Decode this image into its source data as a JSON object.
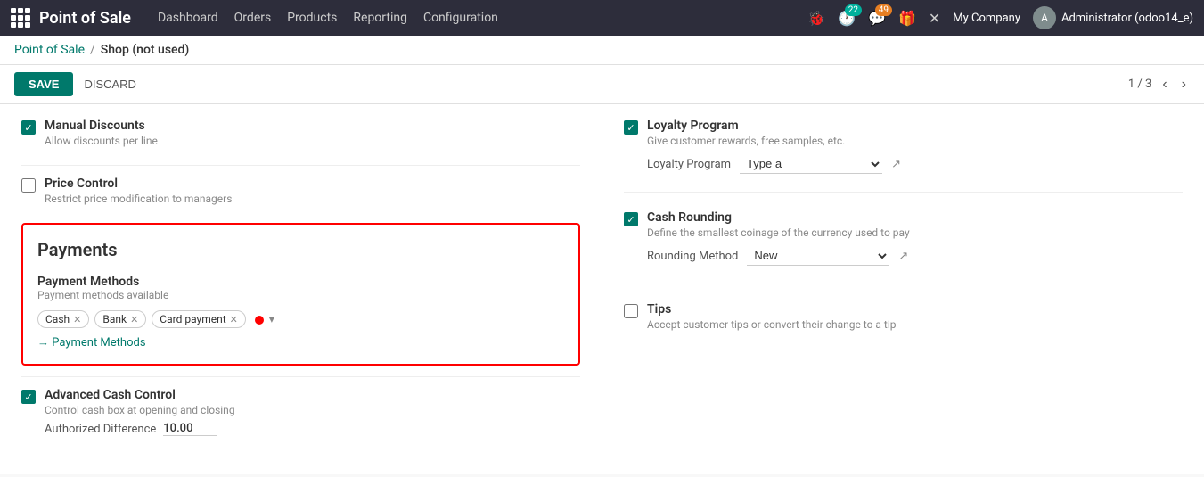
{
  "app": {
    "title": "Point of Sale"
  },
  "nav": {
    "links": [
      "Dashboard",
      "Orders",
      "Products",
      "Reporting",
      "Configuration"
    ],
    "notification_count": "22",
    "message_count": "49",
    "company": "My Company",
    "user": "Administrator (odoo14_e)"
  },
  "breadcrumb": {
    "parent": "Point of Sale",
    "separator": "/",
    "current": "Shop (not used)"
  },
  "action_bar": {
    "save_label": "SAVE",
    "discard_label": "DISCARD",
    "pagination": "1 / 3"
  },
  "left": {
    "manual_discounts": {
      "title": "Manual Discounts",
      "description": "Allow discounts per line",
      "checked": true
    },
    "price_control": {
      "title": "Price Control",
      "description": "Restrict price modification to managers",
      "checked": false
    },
    "payments": {
      "section_title": "Payments",
      "payment_methods_label": "Payment Methods",
      "payment_methods_desc": "Payment methods available",
      "tags": [
        "Cash",
        "Bank",
        "Card payment"
      ],
      "payment_link": "→ Payment Methods"
    },
    "advanced_cash": {
      "title": "Advanced Cash Control",
      "description": "Control cash box at opening and closing",
      "checked": true,
      "authorized_label": "Authorized Difference",
      "authorized_value": "10.00"
    }
  },
  "right": {
    "loyalty_program": {
      "title": "Loyalty Program",
      "description": "Give customer rewards, free samples, etc.",
      "field_label": "Loyalty Program",
      "field_value": "Type a",
      "checked": true
    },
    "cash_rounding": {
      "title": "Cash Rounding",
      "description": "Define the smallest coinage of the currency used to pay",
      "checked": true,
      "rounding_label": "Rounding Method",
      "rounding_value": "New"
    },
    "tips": {
      "title": "Tips",
      "description": "Accept customer tips or convert their change to a tip",
      "checked": false
    }
  }
}
